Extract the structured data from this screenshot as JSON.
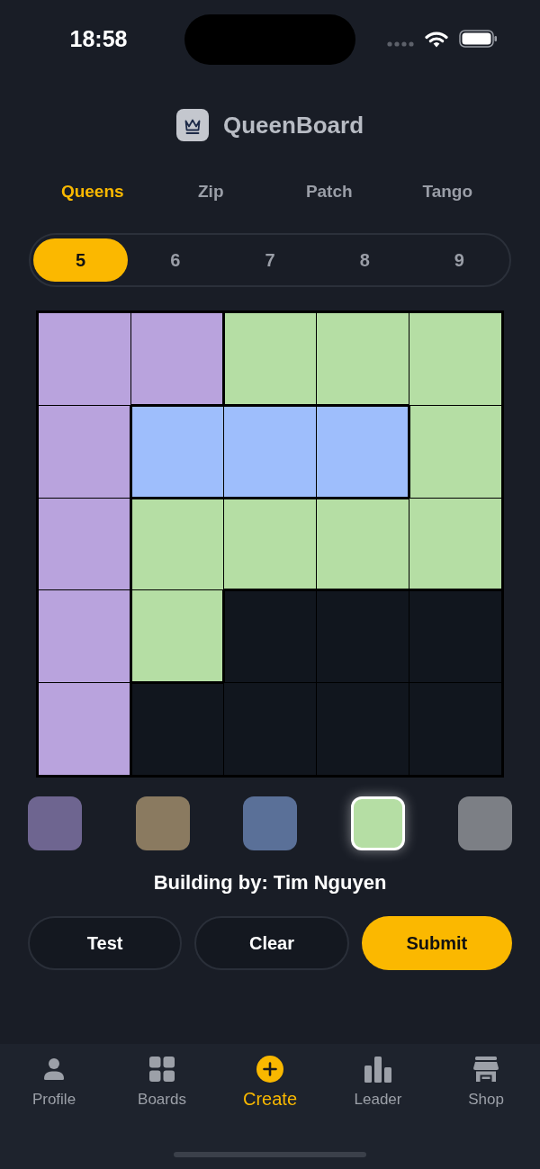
{
  "status_bar": {
    "time": "18:58"
  },
  "header": {
    "title": "QueenBoard"
  },
  "game_tabs": [
    {
      "label": "Queens",
      "selected": true
    },
    {
      "label": "Zip",
      "selected": false
    },
    {
      "label": "Patch",
      "selected": false
    },
    {
      "label": "Tango",
      "selected": false
    }
  ],
  "size_picker": [
    {
      "label": "5",
      "selected": true
    },
    {
      "label": "6",
      "selected": false
    },
    {
      "label": "7",
      "selected": false
    },
    {
      "label": "8",
      "selected": false
    },
    {
      "label": "9",
      "selected": false
    }
  ],
  "board": {
    "rows": [
      [
        {
          "color": "#b9a3dd"
        },
        {
          "color": "#b9a3dd"
        },
        {
          "color": "#b5dea4"
        },
        {
          "color": "#b5dea4"
        },
        {
          "color": "#b5dea4"
        }
      ],
      [
        {
          "color": "#b9a3dd"
        },
        {
          "color": "#9ebefc"
        },
        {
          "color": "#9ebefc"
        },
        {
          "color": "#9ebefc"
        },
        {
          "color": "#b5dea4"
        }
      ],
      [
        {
          "color": "#b9a3dd"
        },
        {
          "color": "#b5dea4"
        },
        {
          "color": "#b5dea4"
        },
        {
          "color": "#b5dea4"
        },
        {
          "color": "#b5dea4"
        }
      ],
      [
        {
          "color": "#b9a3dd"
        },
        {
          "color": "#b5dea4"
        },
        {
          "color": "#11161e"
        },
        {
          "color": "#11161e"
        },
        {
          "color": "#11161e"
        }
      ],
      [
        {
          "color": "#b9a3dd"
        },
        {
          "color": "#11161e"
        },
        {
          "color": "#11161e"
        },
        {
          "color": "#11161e"
        },
        {
          "color": "#11161e"
        }
      ]
    ]
  },
  "palette": [
    {
      "color": "#6e6590",
      "selected": false
    },
    {
      "color": "#8a7a60",
      "selected": false
    },
    {
      "color": "#5a7098",
      "selected": false
    },
    {
      "color": "#b5dea4",
      "selected": true
    },
    {
      "color": "#7c7f85",
      "selected": false
    }
  ],
  "builder_text": "Building by: Tim Nguyen",
  "actions": [
    {
      "label": "Test",
      "kind": "secondary"
    },
    {
      "label": "Clear",
      "kind": "secondary"
    },
    {
      "label": "Submit",
      "kind": "primary"
    }
  ],
  "tab_bar": [
    {
      "label": "Profile",
      "selected": false
    },
    {
      "label": "Boards",
      "selected": false
    },
    {
      "label": "Create",
      "selected": true
    },
    {
      "label": "Leader",
      "selected": false
    },
    {
      "label": "Shop",
      "selected": false
    }
  ]
}
